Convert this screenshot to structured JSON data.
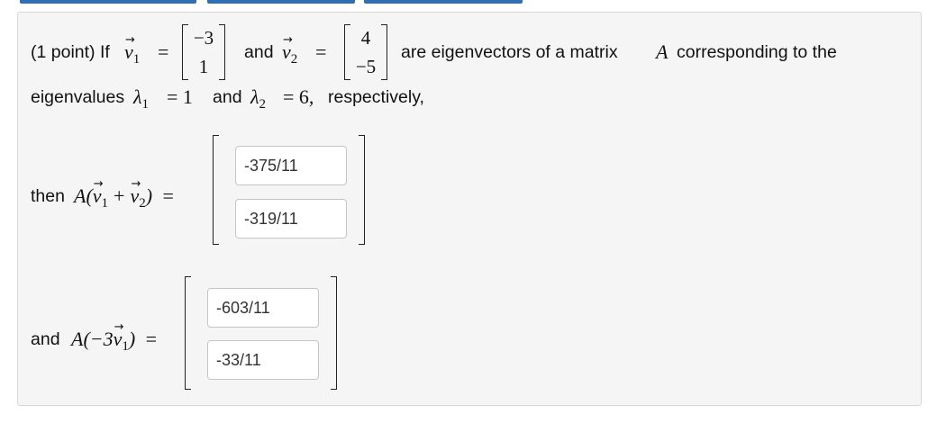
{
  "problem": {
    "points": "(1 point) If",
    "v1_label": "v",
    "v1_sub": "1",
    "eq": "=",
    "v1": [
      "−3",
      "1"
    ],
    "and_word": "and",
    "v2_label": "v",
    "v2_sub": "2",
    "v2": [
      "4",
      "−5"
    ],
    "tail_a": "are eigenvectors of a matrix",
    "matrix": "A",
    "tail_b": "corresponding to the",
    "eigen_word": "eigenvalues",
    "lambda": "λ",
    "l1_sub": "1",
    "l1_val": "= 1",
    "and_word2": "and",
    "l2_sub": "2",
    "l2_val": "= 6,",
    "respectively": "respectively,"
  },
  "part1": {
    "then_word": "then",
    "expr_open": "A(",
    "plus": "+",
    "expr_close": ")",
    "eq": "=",
    "answers": [
      "-375/11",
      "-319/11"
    ]
  },
  "part2": {
    "and_word": "and",
    "expr_open": "A(−3",
    "expr_close": ")",
    "eq": "=",
    "answers": [
      "-603/11",
      "-33/11"
    ]
  },
  "colors": {
    "tab_accent": "#2f6fb4",
    "panel_bg": "#f5f5f5"
  }
}
